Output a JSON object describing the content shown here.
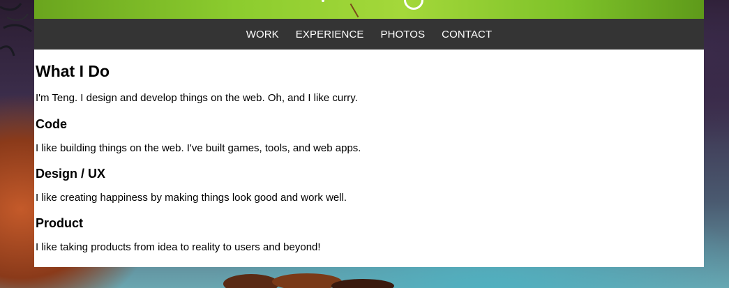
{
  "hero": {
    "image": "hero-banner"
  },
  "nav": {
    "items": [
      {
        "label": "WORK"
      },
      {
        "label": "EXPERIENCE"
      },
      {
        "label": "PHOTOS"
      },
      {
        "label": "CONTACT"
      }
    ]
  },
  "main": {
    "title": "What I Do",
    "intro": "I'm Teng. I design and develop things on the web. Oh, and I like curry.",
    "sections": [
      {
        "heading": "Code",
        "text": "I like building things on the web. I've built games, tools, and web apps."
      },
      {
        "heading": "Design / UX",
        "text": "I like creating happiness by making things look good and work well."
      },
      {
        "heading": "Product",
        "text": "I like taking products from idea to reality to users and beyond!"
      }
    ]
  },
  "colors": {
    "nav_bg": "#343434",
    "nav_text": "#ffffff",
    "content_bg": "#ffffff",
    "hero_green": "#8ccc2e"
  }
}
